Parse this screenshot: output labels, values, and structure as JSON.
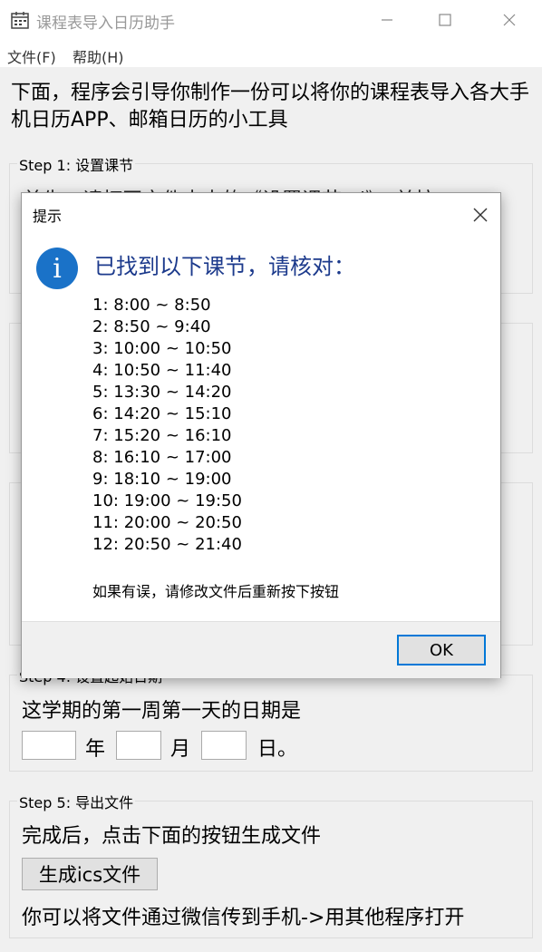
{
  "window": {
    "title": "课程表导入日历助手",
    "controls": [
      "minimize-icon",
      "maximize-icon",
      "close-icon"
    ]
  },
  "menu": {
    "file": "文件(F)",
    "help": "帮助(H)"
  },
  "intro": "下面，程序会引导你制作一份可以将你的课程表导入各大手机日历APP、邮箱日历的小工具",
  "steps": {
    "step1": {
      "title": "Step 1: 设置课节",
      "peek_text": "首先，请打开文件夹中的《设置课节.xl》，并按"
    },
    "step4": {
      "title": "Step 4: 设置起始日期",
      "prompt": "这学期的第一周第一天的日期是",
      "year_label": "年",
      "month_label": "月",
      "day_label": "日。"
    },
    "step5": {
      "title": "Step 5: 导出文件",
      "prompt": "完成后，点击下面的按钮生成文件",
      "button": "生成ics文件",
      "footer": "你可以将文件通过微信传到手机->用其他程序打开"
    }
  },
  "dialog": {
    "title": "提示",
    "heading": "已找到以下课节，请核对：",
    "lessons": [
      "1:  8:00 ~ 8:50",
      "2:  8:50 ~ 9:40",
      "3:  10:00 ~ 10:50",
      "4:  10:50 ~ 11:40",
      "5:  13:30 ~ 14:20",
      "6:  14:20 ~ 15:10",
      "7:  15:20 ~ 16:10",
      "8:  16:10 ~ 17:00",
      "9:  18:10 ~ 19:00",
      "10:  19:00 ~ 19:50",
      "11:  20:00 ~ 20:50",
      "12:  20:50 ~ 21:40"
    ],
    "note": "如果有误，请修改文件后重新按下按钮",
    "ok_button": "OK"
  },
  "colors": {
    "accent": "#0078d7",
    "heading": "#1c3a8c",
    "info_icon": "#1a72c8"
  }
}
